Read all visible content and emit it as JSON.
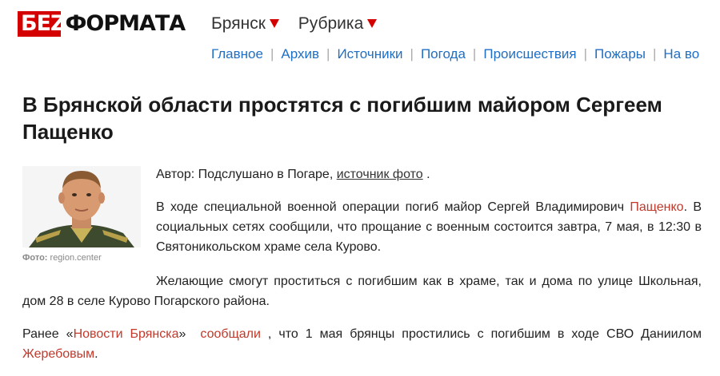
{
  "header": {
    "logo_part1": "БЕZ",
    "logo_part2": "ФОРМАТА",
    "city": "Брянск",
    "rubric": "Рубрика"
  },
  "nav": [
    "Главное",
    "Архив",
    "Источники",
    "Погода",
    "Происшествия",
    "Пожары",
    "На во"
  ],
  "article": {
    "title": "В Брянской области простятся с погибшим майором Сергеем Пащенко",
    "photo_caption_label": "Фото:",
    "photo_caption_source": "region.center",
    "author_prefix": "Автор: Подслушано в Погаре,",
    "author_link": "источник фото",
    "author_suffix": ".",
    "p1_before": "В ходе специальной военной операции погиб майор Сергей Владимирович",
    "p1_link": "Пащенко",
    "p1_after": ". В социальных сетях сообщили, что прощание с военным состоится завтра, 7 мая, в 12:30 в Святоникольском храме села Курово.",
    "p2": "Желающие смогут проститься с погибшим как в храме, так и дома по улице Школьная, дом 28 в селе Курово Погарского района.",
    "p3_before": "Ранее «",
    "p3_link1": "Новости Брянска",
    "p3_mid1": "»",
    "p3_link2": "сообщали",
    "p3_mid2": ", что 1 мая брянцы простились с погибшим в ходе СВО Даниилом",
    "p3_link3": "Жеребовым",
    "p3_end": "."
  },
  "colors": {
    "accent": "#d40000",
    "link": "#1f6fc5",
    "article_link": "#c0392b"
  }
}
